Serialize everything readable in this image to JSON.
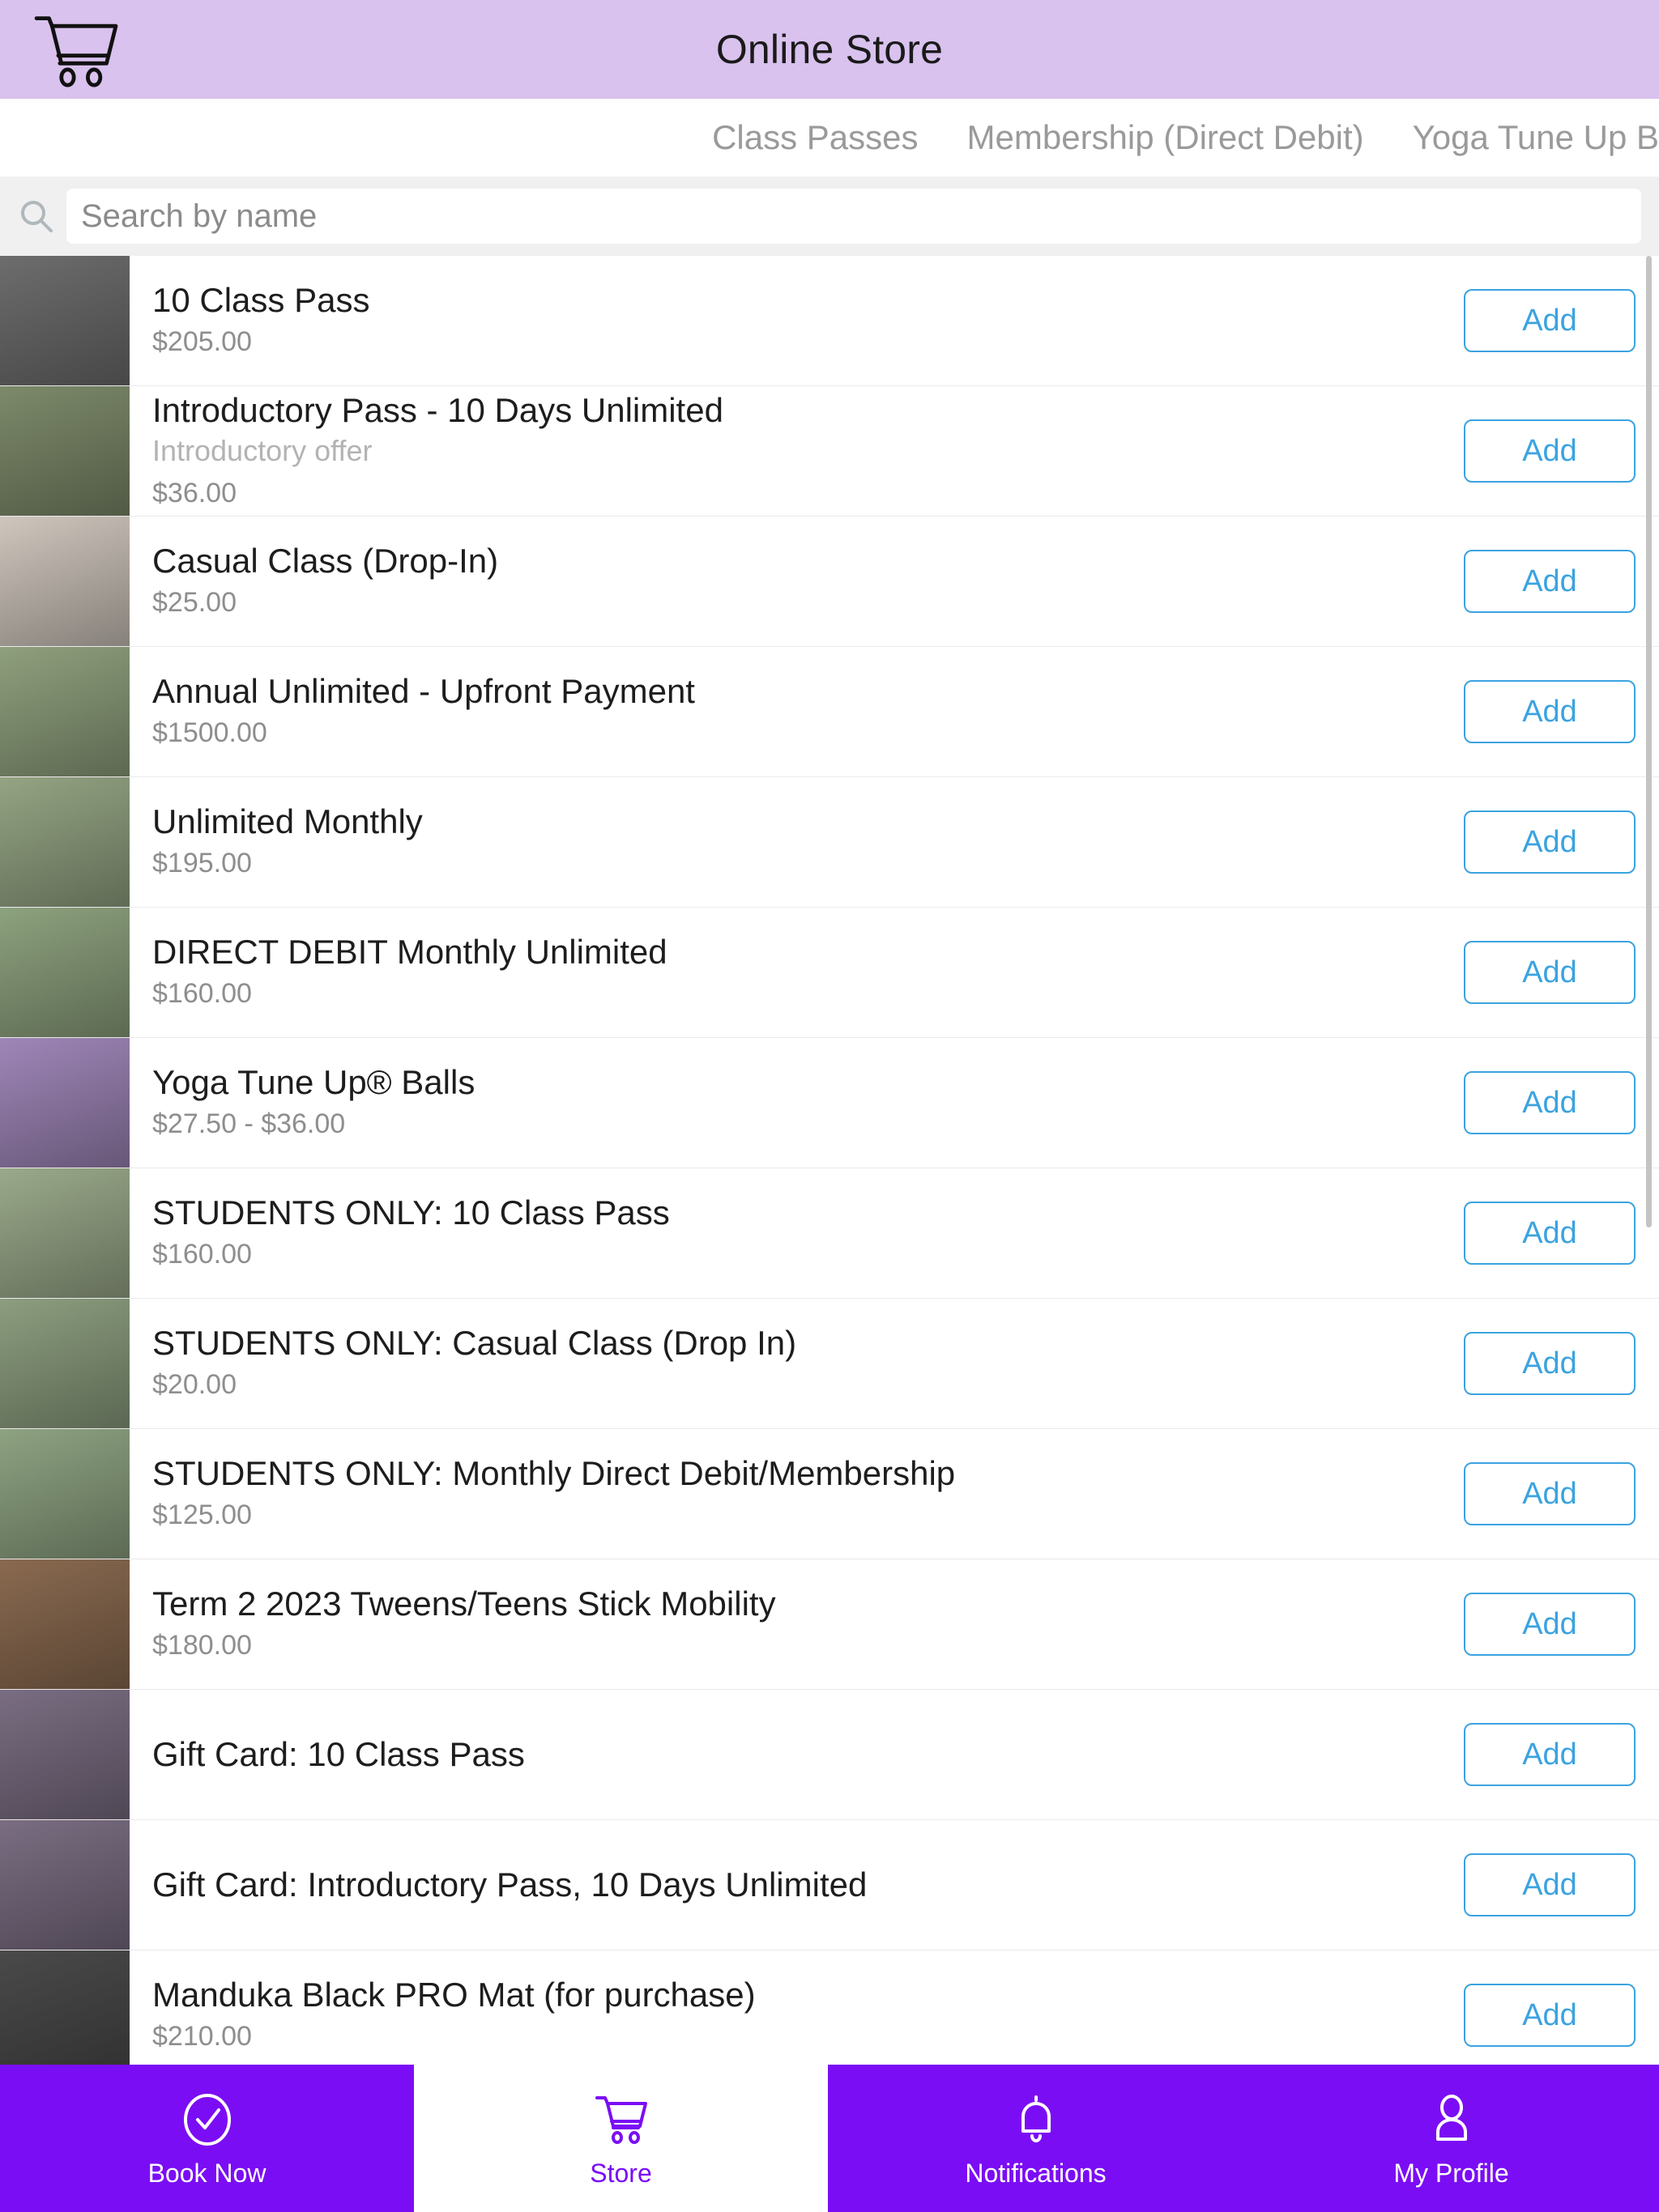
{
  "header": {
    "title": "Online Store",
    "cart_icon": "shopping-cart-icon",
    "background_color": "#d9c2ee"
  },
  "tabs": [
    {
      "label": "Class Passes",
      "selected": false
    },
    {
      "label": "Membership (Direct Debit)",
      "selected": false
    },
    {
      "label": "Yoga Tune Up B",
      "selected": false,
      "truncated": true
    }
  ],
  "search": {
    "placeholder": "Search by name",
    "value": "",
    "icon": "magnifier-icon"
  },
  "list": {
    "add_label": "Add",
    "products": [
      {
        "name": "10 Class Pass",
        "subtitle": "",
        "price": "$205.00",
        "thumb": "#6d6d6d"
      },
      {
        "name": "Introductory Pass - 10 Days Unlimited",
        "subtitle": "Introductory offer",
        "price": "$36.00",
        "thumb": "#7d8a6a"
      },
      {
        "name": "Casual Class (Drop-In)",
        "subtitle": "",
        "price": "$25.00",
        "thumb": "#cfc6bd"
      },
      {
        "name": "Annual Unlimited - Upfront Payment",
        "subtitle": "",
        "price": "$1500.00",
        "thumb": "#8fa07d"
      },
      {
        "name": "Unlimited Monthly",
        "subtitle": "",
        "price": "$195.00",
        "thumb": "#94a483"
      },
      {
        "name": "DIRECT DEBIT Monthly Unlimited",
        "subtitle": "",
        "price": "$160.00",
        "thumb": "#8da27e"
      },
      {
        "name": "Yoga Tune Up® Balls",
        "subtitle": "",
        "price": "$27.50 - $36.00",
        "thumb": "#9f86b8"
      },
      {
        "name": "STUDENTS ONLY: 10 Class Pass",
        "subtitle": "",
        "price": "$160.00",
        "thumb": "#9aa98a"
      },
      {
        "name": "STUDENTS ONLY: Casual Class (Drop In)",
        "subtitle": "",
        "price": "$20.00",
        "thumb": "#8c9e7f"
      },
      {
        "name": "STUDENTS ONLY: Monthly Direct Debit/Membership",
        "subtitle": "",
        "price": "$125.00",
        "thumb": "#8ea382"
      },
      {
        "name": "Term 2 2023 Tweens/Teens Stick Mobility",
        "subtitle": "",
        "price": "$180.00",
        "thumb": "#8a6a50"
      },
      {
        "name": "Gift Card: 10 Class Pass",
        "subtitle": "",
        "price": "",
        "thumb": "#7a6d82"
      },
      {
        "name": "Gift Card: Introductory Pass, 10 Days Unlimited",
        "subtitle": "",
        "price": "",
        "thumb": "#7a6d82"
      },
      {
        "name": "Manduka Black PRO Mat (for purchase)",
        "subtitle": "",
        "price": "$210.00",
        "thumb": "#4a4a4a"
      }
    ]
  },
  "bottom_nav": {
    "items": [
      {
        "label": "Book Now",
        "icon": "check-circle-icon",
        "style": "active-purple"
      },
      {
        "label": "Store",
        "icon": "cart-icon",
        "style": "plain-white"
      },
      {
        "label": "Notifications",
        "icon": "bell-icon",
        "style": "active-purple"
      },
      {
        "label": "My Profile",
        "icon": "person-icon",
        "style": "active-purple"
      }
    ],
    "accent_color": "#7b0df5"
  }
}
